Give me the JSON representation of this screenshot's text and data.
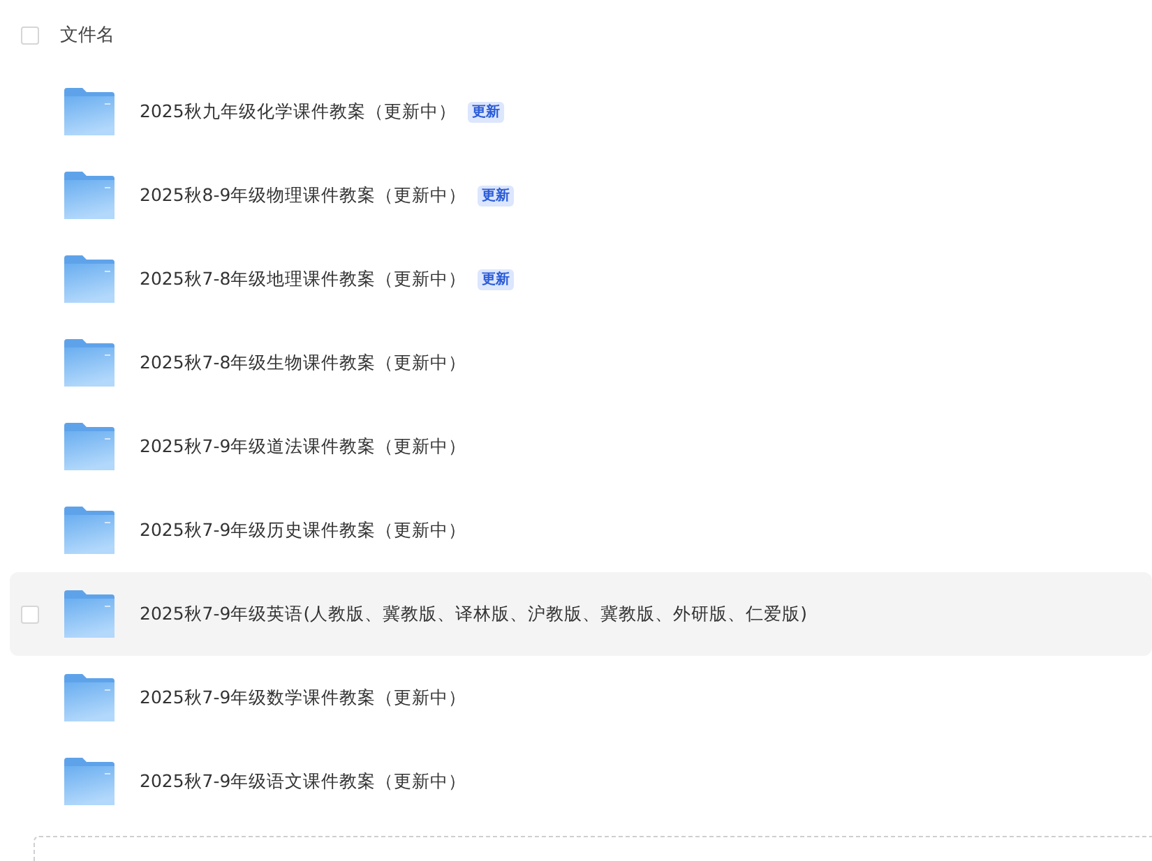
{
  "header": {
    "checked": false,
    "label": "文件名"
  },
  "files": [
    {
      "name": "2025秋九年级化学课件教案（更新中）",
      "badge": "更新",
      "hovered": false
    },
    {
      "name": "2025秋8-9年级物理课件教案（更新中）",
      "badge": "更新",
      "hovered": false
    },
    {
      "name": "2025秋7-8年级地理课件教案（更新中）",
      "badge": "更新",
      "hovered": false
    },
    {
      "name": "2025秋7-8年级生物课件教案（更新中）",
      "hovered": false
    },
    {
      "name": "2025秋7-9年级道法课件教案（更新中）",
      "hovered": false
    },
    {
      "name": "2025秋7-9年级历史课件教案（更新中）",
      "hovered": false
    },
    {
      "name": "2025秋7-9年级英语(人教版、冀教版、译林版、沪教版、冀教版、外研版、仁爱版)",
      "hovered": true,
      "checked": false
    },
    {
      "name": "2025秋7-9年级数学课件教案（更新中）",
      "hovered": false
    },
    {
      "name": "2025秋7-9年级语文课件教案（更新中）",
      "hovered": false
    }
  ]
}
